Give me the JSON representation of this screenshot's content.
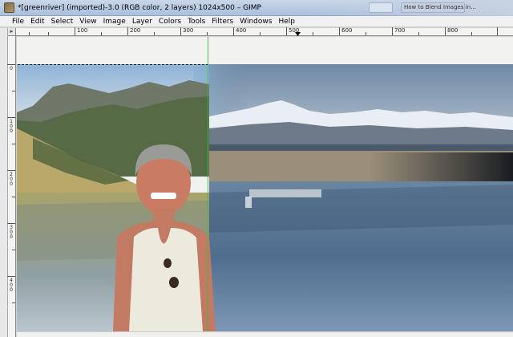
{
  "window": {
    "title": "*[greenriver] (imported)-3.0 (RGB color, 2 layers) 1024x500 – GIMP",
    "bg_window_label": "How to Blend Images in..."
  },
  "menu": [
    "File",
    "Edit",
    "Select",
    "View",
    "Image",
    "Layer",
    "Colors",
    "Tools",
    "Filters",
    "Windows",
    "Help"
  ],
  "hruler": {
    "labels": [
      "100",
      "200",
      "300",
      "400",
      "500",
      "600",
      "700",
      "800"
    ]
  },
  "vruler": {
    "labels": [
      "0",
      "100",
      "200",
      "300",
      "400"
    ]
  },
  "colors": {
    "guide": "#3cbd3c",
    "sky_left": "#8fb3d6",
    "sky_right": "#6e8aa6",
    "lake": "#4f6d8d"
  },
  "icons": {
    "app": "gimp-icon",
    "ruler_corner": "ruler-corner-icon",
    "pointer": "pointer-position-triangle-icon"
  }
}
